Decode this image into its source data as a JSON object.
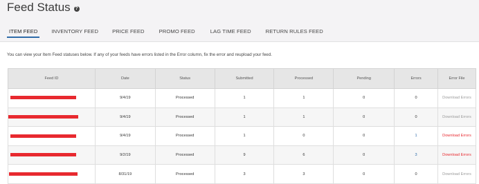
{
  "header": {
    "title": "Feed Status",
    "help_icon": "?"
  },
  "tabs": [
    {
      "label": "ITEM FEED",
      "active": true
    },
    {
      "label": "INVENTORY FEED",
      "active": false
    },
    {
      "label": "PRICE FEED",
      "active": false
    },
    {
      "label": "PROMO FEED",
      "active": false
    },
    {
      "label": "LAG TIME FEED",
      "active": false
    },
    {
      "label": "RETURN RULES FEED",
      "active": false
    }
  ],
  "intro_text": "You can view your Item Feed statuses below. If any of your feeds have errors listed in the Error column, fix the error and reupload your feed.",
  "table": {
    "columns": [
      "Feed ID",
      "Date",
      "Status",
      "Submitted",
      "Processed",
      "Pending",
      "Errors",
      "Error File"
    ],
    "rows": [
      {
        "date": "9/4/19",
        "status": "Processed",
        "submitted": "1",
        "processed": "1",
        "pending": "0",
        "errors": "0",
        "error_file": "Download Errors",
        "error_file_active": false
      },
      {
        "date": "9/4/19",
        "status": "Processed",
        "submitted": "1",
        "processed": "1",
        "pending": "0",
        "errors": "0",
        "error_file": "Download Errors",
        "error_file_active": false
      },
      {
        "date": "9/4/19",
        "status": "Processed",
        "submitted": "1",
        "processed": "0",
        "pending": "0",
        "errors": "1",
        "error_file": "Download Errors",
        "error_file_active": true
      },
      {
        "date": "9/2/19",
        "status": "Processed",
        "submitted": "9",
        "processed": "6",
        "pending": "0",
        "errors": "3",
        "error_file": "Download Errors",
        "error_file_active": true
      },
      {
        "date": "8/31/19",
        "status": "Processed",
        "submitted": "3",
        "processed": "3",
        "pending": "0",
        "errors": "0",
        "error_file": "Download Errors",
        "error_file_active": false
      }
    ]
  },
  "colors": {
    "accent": "#2d6aa8",
    "error": "#e8292f",
    "header_bg": "#f4f3f5",
    "table_header_bg": "#e6e6e6"
  }
}
